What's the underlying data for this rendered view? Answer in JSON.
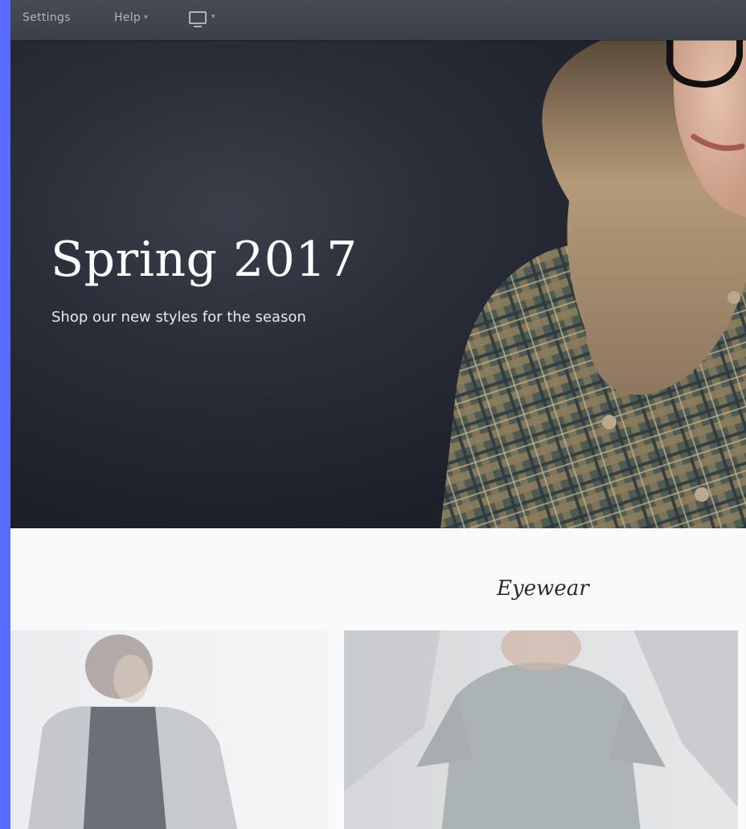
{
  "toolbar": {
    "settings_label": "Settings",
    "help_label": "Help",
    "help_caret": "▾",
    "display_caret": "▾"
  },
  "hero": {
    "title": "Spring 2017",
    "subtitle": "Shop our new styles for the season"
  },
  "section": {
    "heading": "Eyewear"
  },
  "colors": {
    "frame_accent": "#5b6bff",
    "toolbar_bg": "#424650",
    "hero_bg": "#262a33"
  },
  "icons": {
    "display": "monitor-icon"
  }
}
